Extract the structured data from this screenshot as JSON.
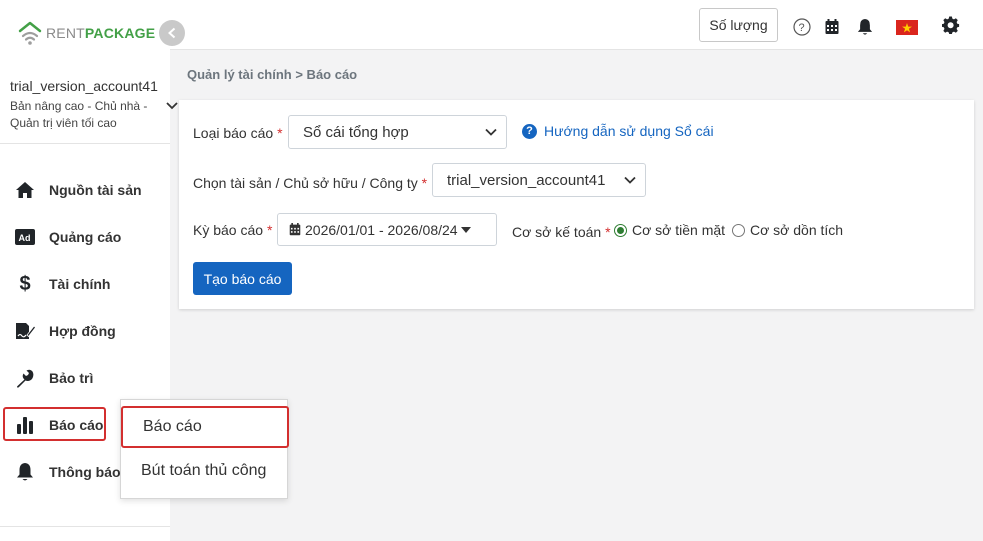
{
  "logo": {
    "part1": "RENT",
    "part2": "PACKAGE"
  },
  "account": {
    "name": "trial_version_account41",
    "role": "Bản nâng cao - Chủ nhà - Quản trị viên tối cao"
  },
  "sidebar": {
    "items": [
      {
        "label": "Nguồn tài sản",
        "icon": "home-icon"
      },
      {
        "label": "Quảng cáo",
        "icon": "ad-icon"
      },
      {
        "label": "Tài chính",
        "icon": "dollar-icon"
      },
      {
        "label": "Hợp đồng",
        "icon": "contract-icon"
      },
      {
        "label": "Bảo trì",
        "icon": "wrench-icon"
      },
      {
        "label": "Báo cáo",
        "icon": "bar-chart-icon"
      },
      {
        "label": "Thông báo",
        "icon": "bell-icon"
      }
    ]
  },
  "topbar": {
    "quantity_label": "Số lượng"
  },
  "breadcrumb": "Quản lý tài chính > Báo cáo",
  "form": {
    "report_type_label": "Loại báo cáo",
    "report_type_value": "Sổ cái tổng hợp",
    "help_link": "Hướng dẫn sử dụng Sổ cái",
    "asset_label": "Chọn tài sản / Chủ sở hữu / Công ty",
    "asset_value": "trial_version_account41",
    "period_label": "Kỳ báo cáo",
    "period_value": "2026/01/01 - 2026/08/24",
    "basis_label": "Cơ sở kế toán",
    "basis_cash": "Cơ sở tiền mặt",
    "basis_accrual": "Cơ sở dồn tích",
    "required_mark": "*",
    "create_button": "Tạo báo cáo"
  },
  "submenu": {
    "items": [
      "Báo cáo",
      "Bút toán thủ công"
    ]
  },
  "colors": {
    "primary": "#1565c0",
    "brand_green": "#43a047",
    "highlight_red": "#d32f2f"
  }
}
